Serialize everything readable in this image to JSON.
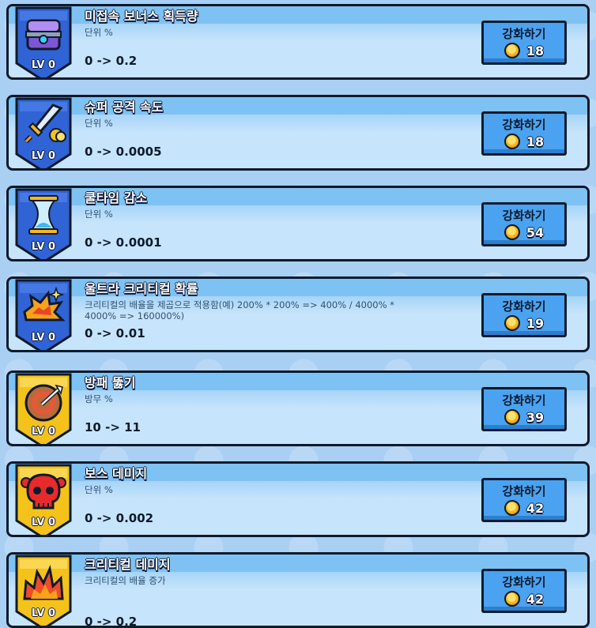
{
  "upgrade_label": "강화하기",
  "colors": {
    "blue_badge": "#2f63d6",
    "yellow_badge": "#f4c21b",
    "button": "#4aa2f0",
    "card": "#c6e4fb"
  },
  "items": [
    {
      "title": "미접속 보너스 획득량",
      "desc": "단위 %",
      "value": "0 -> 0.2",
      "level": "LV 0",
      "cost": "18",
      "badge": "blue",
      "icon": "treasure-chest-icon"
    },
    {
      "title": "슈퍼 공격 속도",
      "desc": "단위 %",
      "value": "0 -> 0.0005",
      "level": "LV 0",
      "cost": "18",
      "badge": "blue",
      "icon": "sword-icon"
    },
    {
      "title": "쿨타임 감소",
      "desc": "단위 %",
      "value": "0 -> 0.0001",
      "level": "LV 0",
      "cost": "54",
      "badge": "blue",
      "icon": "hourglass-icon"
    },
    {
      "title": "울트라 크리티컬 확률",
      "desc": "크리티컬의 배율을 제곱으로 적용함(예) 200% * 200% => 400% / 4000% * 4000% => 160000%)",
      "value": "0 -> 0.01",
      "level": "LV 0",
      "cost": "19",
      "badge": "blue",
      "icon": "explosion-icon"
    },
    {
      "title": "방패 뚫기",
      "desc": "방무 %",
      "value": "10 -> 11",
      "level": "LV 0",
      "cost": "39",
      "badge": "yellow",
      "icon": "target-arrow-icon"
    },
    {
      "title": "보스 데미지",
      "desc": "단위 %",
      "value": "0 -> 0.002",
      "level": "LV 0",
      "cost": "42",
      "badge": "yellow",
      "icon": "skull-icon"
    },
    {
      "title": "크리티컬 데미지",
      "desc": "크리티컬의 배율 증가",
      "value": "0 -> 0.2",
      "level": "LV 0",
      "cost": "42",
      "badge": "yellow",
      "icon": "fire-burst-icon"
    }
  ]
}
